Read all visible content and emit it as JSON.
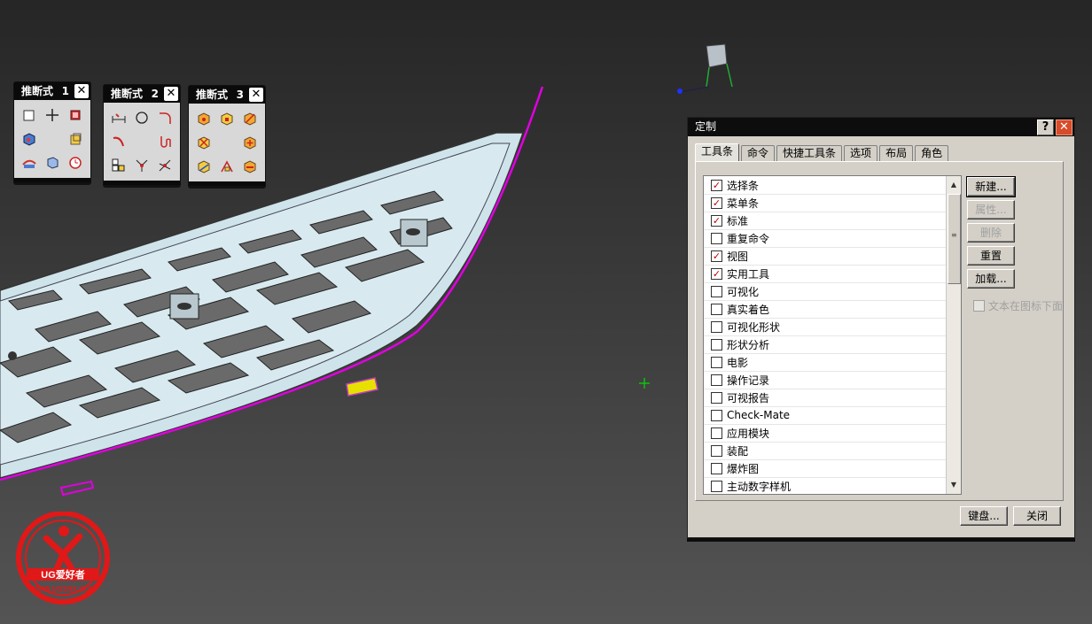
{
  "colors": {
    "list_check": "#c00000",
    "curve": "#e000e0",
    "part": "#d6e8ee",
    "logo_red": "#e01818"
  },
  "toolbars": [
    {
      "title": "推断式",
      "num": "1",
      "icons": [
        "rect-icon",
        "cross-icon",
        "red-box-icon",
        "blue-cube-icon",
        "empty",
        "yellow-box-icon",
        "curve-tool-icon",
        "cube-tool-icon",
        "clock-icon"
      ]
    },
    {
      "title": "推断式",
      "num": "2",
      "icons": [
        "dim-icon",
        "circle-icon",
        "arc-corner-icon",
        "red-arc-icon",
        "empty",
        "red-spiral-icon",
        "multi-box-icon",
        "node-icon",
        "intersect-icon"
      ]
    },
    {
      "title": "推断式",
      "num": "3",
      "icons": [
        "box-a-icon",
        "box-b-icon",
        "box-c-icon",
        "box-d-icon",
        "empty",
        "box-e-icon",
        "box-f-icon",
        "box-g-icon",
        "box-h-icon"
      ]
    }
  ],
  "dialog": {
    "title": "定制",
    "help": "?",
    "tabs": [
      "工具条",
      "命令",
      "快捷工具条",
      "选项",
      "布局",
      "角色"
    ],
    "items": [
      {
        "label": "选择条",
        "checked": true
      },
      {
        "label": "菜单条",
        "checked": true
      },
      {
        "label": "标准",
        "checked": true
      },
      {
        "label": "重复命令",
        "checked": false
      },
      {
        "label": "视图",
        "checked": true
      },
      {
        "label": "实用工具",
        "checked": true
      },
      {
        "label": "可视化",
        "checked": false
      },
      {
        "label": "真实着色",
        "checked": false
      },
      {
        "label": "可视化形状",
        "checked": false
      },
      {
        "label": "形状分析",
        "checked": false
      },
      {
        "label": "电影",
        "checked": false
      },
      {
        "label": "操作记录",
        "checked": false
      },
      {
        "label": "可视报告",
        "checked": false
      },
      {
        "label": "Check-Mate",
        "checked": false
      },
      {
        "label": "应用模块",
        "checked": false
      },
      {
        "label": "装配",
        "checked": false
      },
      {
        "label": "爆炸图",
        "checked": false
      },
      {
        "label": "主动数字样机",
        "checked": false
      }
    ],
    "buttons": {
      "new": "新建...",
      "properties": "属性...",
      "delete": "删除",
      "reset": "重置",
      "load": "加载..."
    },
    "text_under_icon": "文本在图标下面",
    "keyboard": "键盘...",
    "close": "关闭"
  },
  "logo": {
    "brand": "UG爱好者",
    "url": "WWW.UGSNX.COM"
  }
}
